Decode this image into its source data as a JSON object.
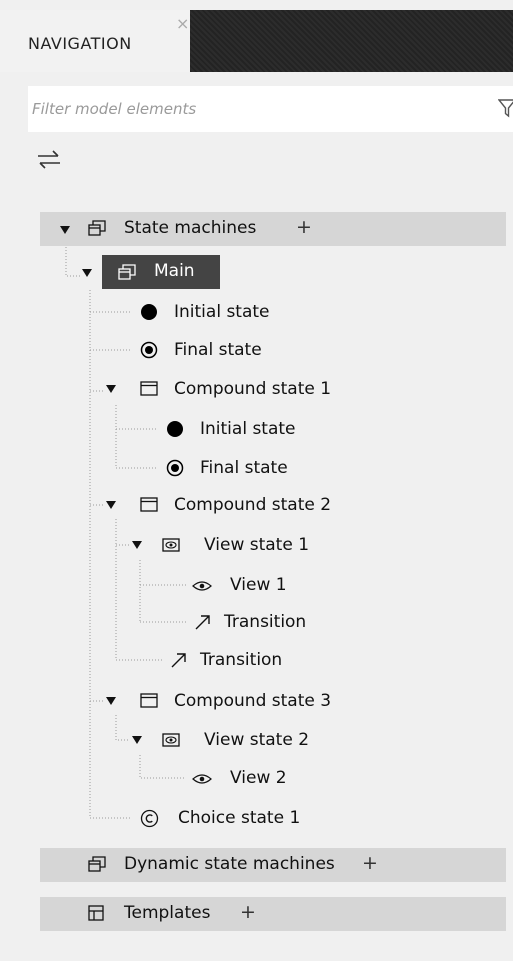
{
  "panel": {
    "tab_label": "NAVIGATION",
    "filter_placeholder": "Filter model elements"
  },
  "tree": {
    "state_machines": {
      "label": "State machines"
    },
    "main": {
      "label": "Main"
    },
    "initial_1": "Initial state",
    "final_1": "Final state",
    "compound_1": "Compound state 1",
    "compound_1_initial": "Initial state",
    "compound_1_final": "Final state",
    "compound_2": "Compound state 2",
    "view_state_1": "View state 1",
    "view_1": "View 1",
    "transition_1": "Transition",
    "transition_2": "Transition",
    "compound_3": "Compound state 3",
    "view_state_2": "View state 2",
    "view_2": "View 2",
    "choice_1": "Choice state 1",
    "dynamic_state_machines": {
      "label": "Dynamic state machines"
    },
    "templates": {
      "label": "Templates"
    }
  }
}
